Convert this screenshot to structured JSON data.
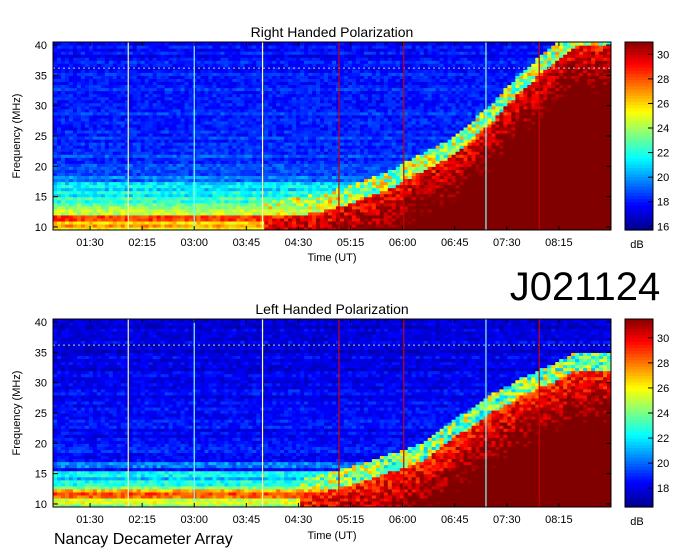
{
  "figure": {
    "label": "J021124",
    "footer": "Nancay Decameter Array"
  },
  "chart_data": [
    {
      "type": "heatmap",
      "title": "Right Handed Polarization",
      "xlabel": "Time (UT)",
      "ylabel": "Frequency (MHz)",
      "x_ticks": [
        "01:30",
        "02:15",
        "03:00",
        "03:45",
        "04:30",
        "05:15",
        "06:00",
        "06:45",
        "07:30",
        "08:15"
      ],
      "x_range": [
        "00:58",
        "09:00"
      ],
      "y_ticks": [
        10,
        15,
        20,
        25,
        30,
        35,
        40
      ],
      "ylim": [
        9.5,
        40.5
      ],
      "colorbar": {
        "label": "dB",
        "ticks": [
          16,
          18,
          20,
          22,
          24,
          26,
          28,
          30
        ],
        "range": [
          15.7,
          31
        ]
      },
      "colormap": [
        "#00008f",
        "#0000ff",
        "#0080ff",
        "#00ffff",
        "#80ff80",
        "#ffff00",
        "#ff8000",
        "#ff0000",
        "#800000"
      ],
      "vertical_lines": [
        {
          "time": "02:03",
          "color": "#ffff99"
        },
        {
          "time": "03:00",
          "color": "#80ffff"
        },
        {
          "time": "03:59",
          "color": "#ffff99"
        },
        {
          "time": "05:05",
          "color": "#cc0000"
        },
        {
          "time": "06:01",
          "color": "#cc0000"
        },
        {
          "time": "07:12",
          "color": "#80ffff"
        },
        {
          "time": "07:58",
          "color": "#cc0000"
        }
      ],
      "bands": [
        {
          "freq": 10.3,
          "level": 27
        },
        {
          "freq": 11.5,
          "level": 29
        },
        {
          "freq": 12.5,
          "level": 25
        },
        {
          "freq": 13.4,
          "level": 24
        },
        {
          "freq": 14.6,
          "level": 23
        },
        {
          "freq": 15.8,
          "level": 22
        },
        {
          "freq": 16.9,
          "level": 22
        },
        {
          "freq": 18.1,
          "level": 20
        }
      ],
      "onset": [
        {
          "time": "04:00",
          "freq": 11
        },
        {
          "time": "05:00",
          "freq": 13
        },
        {
          "time": "05:45",
          "freq": 16
        },
        {
          "time": "06:15",
          "freq": 19
        },
        {
          "time": "06:45",
          "freq": 22
        },
        {
          "time": "07:15",
          "freq": 27
        },
        {
          "time": "07:45",
          "freq": 33
        },
        {
          "time": "08:30",
          "freq": 40
        }
      ]
    },
    {
      "type": "heatmap",
      "title": "Left Handed Polarization",
      "xlabel": "Time (UT)",
      "ylabel": "Frequency (MHz)",
      "x_ticks": [
        "01:30",
        "02:15",
        "03:00",
        "03:45",
        "04:30",
        "05:15",
        "06:00",
        "06:45",
        "07:30",
        "08:15"
      ],
      "x_range": [
        "00:58",
        "09:00"
      ],
      "y_ticks": [
        10,
        15,
        20,
        25,
        30,
        35,
        40
      ],
      "ylim": [
        9.5,
        40.5
      ],
      "colorbar": {
        "label": "dB",
        "ticks": [
          18,
          20,
          22,
          24,
          26,
          28,
          30
        ],
        "range": [
          16.5,
          31.5
        ]
      },
      "colormap": [
        "#00008f",
        "#0000ff",
        "#0080ff",
        "#00ffff",
        "#80ff80",
        "#ffff00",
        "#ff8000",
        "#ff0000",
        "#800000"
      ],
      "vertical_lines": [
        {
          "time": "02:03",
          "color": "#ffff99"
        },
        {
          "time": "03:00",
          "color": "#80ffff"
        },
        {
          "time": "03:59",
          "color": "#ffff99"
        },
        {
          "time": "05:05",
          "color": "#cc0000"
        },
        {
          "time": "06:01",
          "color": "#cc0000"
        },
        {
          "time": "07:12",
          "color": "#80ffff"
        },
        {
          "time": "07:58",
          "color": "#cc0000"
        }
      ],
      "bands": [
        {
          "freq": 10.4,
          "level": 26
        },
        {
          "freq": 11.6,
          "level": 29
        },
        {
          "freq": 12.7,
          "level": 24
        },
        {
          "freq": 13.6,
          "level": 23
        },
        {
          "freq": 15.0,
          "level": 23
        },
        {
          "freq": 16.5,
          "level": 21
        }
      ],
      "onset": [
        {
          "time": "04:30",
          "freq": 11
        },
        {
          "time": "05:30",
          "freq": 14
        },
        {
          "time": "06:15",
          "freq": 17
        },
        {
          "time": "06:45",
          "freq": 21
        },
        {
          "time": "07:15",
          "freq": 25
        },
        {
          "time": "07:45",
          "freq": 28
        },
        {
          "time": "08:30",
          "freq": 32
        }
      ]
    }
  ]
}
